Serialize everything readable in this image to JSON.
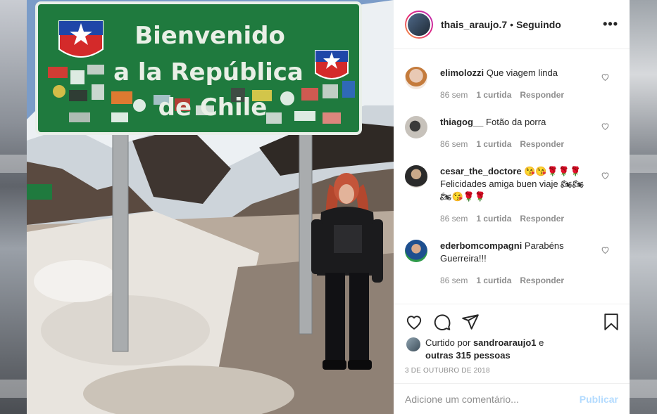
{
  "post": {
    "username": "thais_araujo.7",
    "separator": "•",
    "follow_status": "Seguindo",
    "more_icon": "more-icon"
  },
  "photo": {
    "sign_line1": "Bienvenido",
    "sign_line2": "a la República",
    "sign_line3": "de Chile"
  },
  "comments": [
    {
      "user": "elimolozzi",
      "text": "Que viagem linda",
      "age": "86 sem",
      "likes": "1 curtida",
      "reply": "Responder"
    },
    {
      "user": "thiagog__",
      "text": "Fotão da porra",
      "age": "86 sem",
      "likes": "1 curtida",
      "reply": "Responder"
    },
    {
      "user": "cesar_the_doctore",
      "text": "😘😘🌹🌹🌹 Felicidades amiga buen viaje 🏍🏍🏍😘🌹🌹",
      "age": "86 sem",
      "likes": "1 curtida",
      "reply": "Responder"
    },
    {
      "user": "ederbomcompagni",
      "text": "Parabéns Guerreira!!!",
      "age": "86 sem",
      "likes": "1 curtida",
      "reply": "Responder"
    }
  ],
  "likes": {
    "prefix": "Curtido por",
    "first_user": "sandroaraujo1",
    "connector": "e",
    "others": "outras 315 pessoas"
  },
  "date": "3 DE OUTUBRO DE 2018",
  "add_comment": {
    "placeholder": "Adicione um comentário...",
    "publish_label": "Publicar"
  },
  "colors": {
    "sign_green": "#1f7a3e",
    "publish_disabled": "#b3dbff",
    "text_primary": "#262626",
    "text_secondary": "#8e8e8e"
  }
}
